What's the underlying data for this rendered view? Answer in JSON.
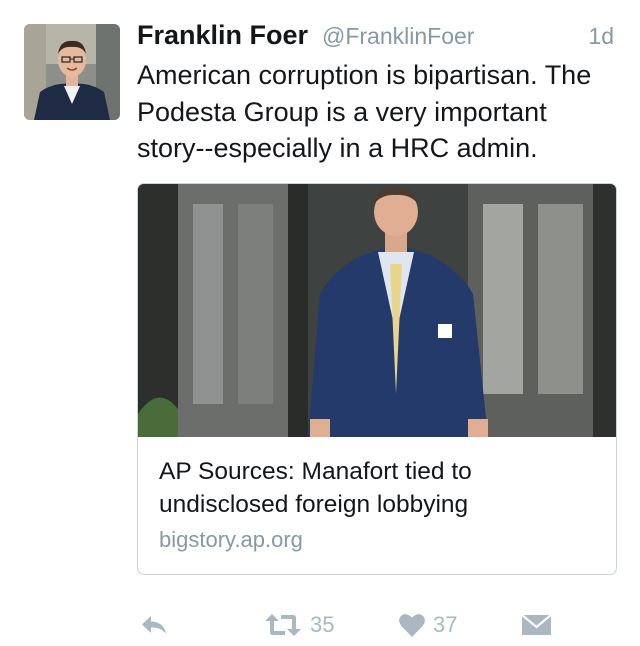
{
  "tweet": {
    "author_name": "Franklin Foer",
    "author_handle": "@FranklinFoer",
    "timestamp": "1d",
    "text": "American corruption is bipartisan. The Podesta Group is a very important story--especially in a HRC admin.",
    "avatar_icon": "profile-photo"
  },
  "card": {
    "title": "AP Sources: Manafort tied to undisclosed foreign lobbying",
    "domain": "bigstory.ap.org",
    "image_icon": "news-photo"
  },
  "actions": {
    "reply_icon": "reply-icon",
    "retweet_icon": "retweet-icon",
    "retweet_count": "35",
    "like_icon": "heart-icon",
    "like_count": "37",
    "dm_icon": "envelope-icon"
  },
  "colors": {
    "text": "#14171a",
    "secondary": "#8899a6",
    "action": "#aab8c2",
    "border": "#c9d3db"
  }
}
